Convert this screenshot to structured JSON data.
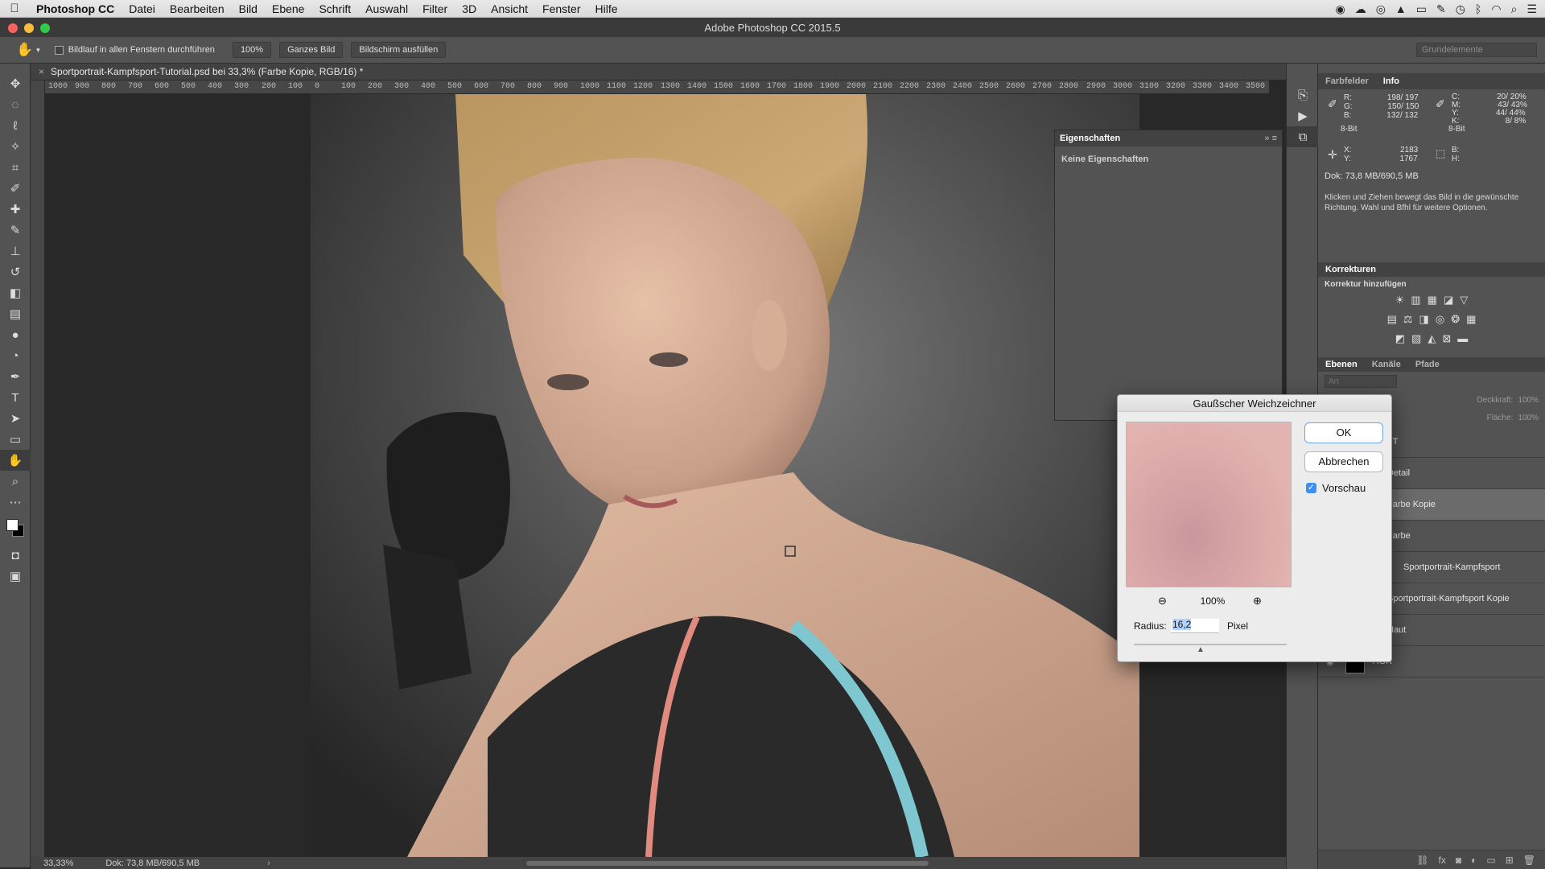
{
  "menubar": {
    "apple": "",
    "app_name": "Photoshop CC",
    "items": [
      "Datei",
      "Bearbeiten",
      "Bild",
      "Ebene",
      "Schrift",
      "Auswahl",
      "Filter",
      "3D",
      "Ansicht",
      "Fenster",
      "Hilfe"
    ]
  },
  "window": {
    "title": "Adobe Photoshop CC 2015.5"
  },
  "options_bar": {
    "scroll_all_label": "Bildlauf in allen Fenstern durchführen",
    "zoom_button": "100%",
    "fit_button": "Ganzes Bild",
    "fill_button": "Bildschirm ausfüllen",
    "workspace": "Grundelemente"
  },
  "document": {
    "tab_title": "Sportportrait-Kampfsport-Tutorial.psd bei 33,3% (Farbe Kopie, RGB/16) *",
    "ruler_ticks": [
      "1000",
      "900",
      "800",
      "700",
      "600",
      "500",
      "400",
      "300",
      "200",
      "100",
      "0",
      "100",
      "200",
      "300",
      "400",
      "500",
      "600",
      "700",
      "800",
      "900",
      "1000",
      "1100",
      "1200",
      "1300",
      "1400",
      "1500",
      "1600",
      "1700",
      "1800",
      "1900",
      "2000",
      "2100",
      "2200",
      "2300",
      "2400",
      "2500",
      "2600",
      "2700",
      "2800",
      "2900",
      "3000",
      "3100",
      "3200",
      "3300",
      "3400",
      "3500"
    ],
    "zoom_status": "33,33%",
    "doc_status": "Dok: 73,8 MB/690,5 MB"
  },
  "properties_panel": {
    "title": "Eigenschaften",
    "empty_text": "Keine Eigenschaften"
  },
  "info_panel": {
    "tabs": [
      "Farbfelder",
      "Info"
    ],
    "active_tab": "Info",
    "rgb": {
      "R": "198/ 197",
      "G": "150/ 150",
      "B": "132/ 132",
      "bits": "8-Bit"
    },
    "cmyk": {
      "C": "20/ 20%",
      "M": "43/ 43%",
      "Y": "44/ 44%",
      "K": "8/ 8%",
      "bits": "8-Bit"
    },
    "xy": {
      "X": "2183",
      "Y": "1767"
    },
    "wh": {
      "B": "",
      "H": ""
    },
    "doc": "Dok: 73,8 MB/690,5 MB",
    "hint": "Klicken und Ziehen bewegt das Bild in die gewünschte Richtung. Wahl und Bfhl für weitere Optionen."
  },
  "corrections_panel": {
    "title": "Korrekturen",
    "subtitle": "Korrektur hinzufügen"
  },
  "layers_panel": {
    "tabs": [
      "Ebenen",
      "Kanäle",
      "Pfade"
    ],
    "active_tab": "Ebenen",
    "search_placeholder": "Art",
    "opacity_label": "Deckkraft:",
    "opacity_value": "100%",
    "fill_label": "Fläche:",
    "fill_value": "100%",
    "layers": [
      {
        "name": "FT",
        "selected": false
      },
      {
        "name": "Detail",
        "selected": false
      },
      {
        "name": "Farbe Kopie",
        "selected": true
      },
      {
        "name": "Farbe",
        "selected": false
      },
      {
        "name": "Sportportrait-Kampfsport",
        "selected": false
      },
      {
        "name": "Sportportrait-Kampfsport Kopie",
        "selected": false
      },
      {
        "name": "Haut",
        "selected": false
      },
      {
        "name": "HGR",
        "selected": false
      }
    ]
  },
  "gauss_dialog": {
    "title": "Gaußscher Weichzeichner",
    "ok": "OK",
    "cancel": "Abbrechen",
    "preview_label": "Vorschau",
    "preview_checked": true,
    "preview_zoom": "100%",
    "radius_label": "Radius:",
    "radius_value": "16,2",
    "unit": "Pixel"
  },
  "colors": {
    "accent": "#3b8ef2",
    "panel_bg": "#535353",
    "canvas_bg": "#282828"
  }
}
